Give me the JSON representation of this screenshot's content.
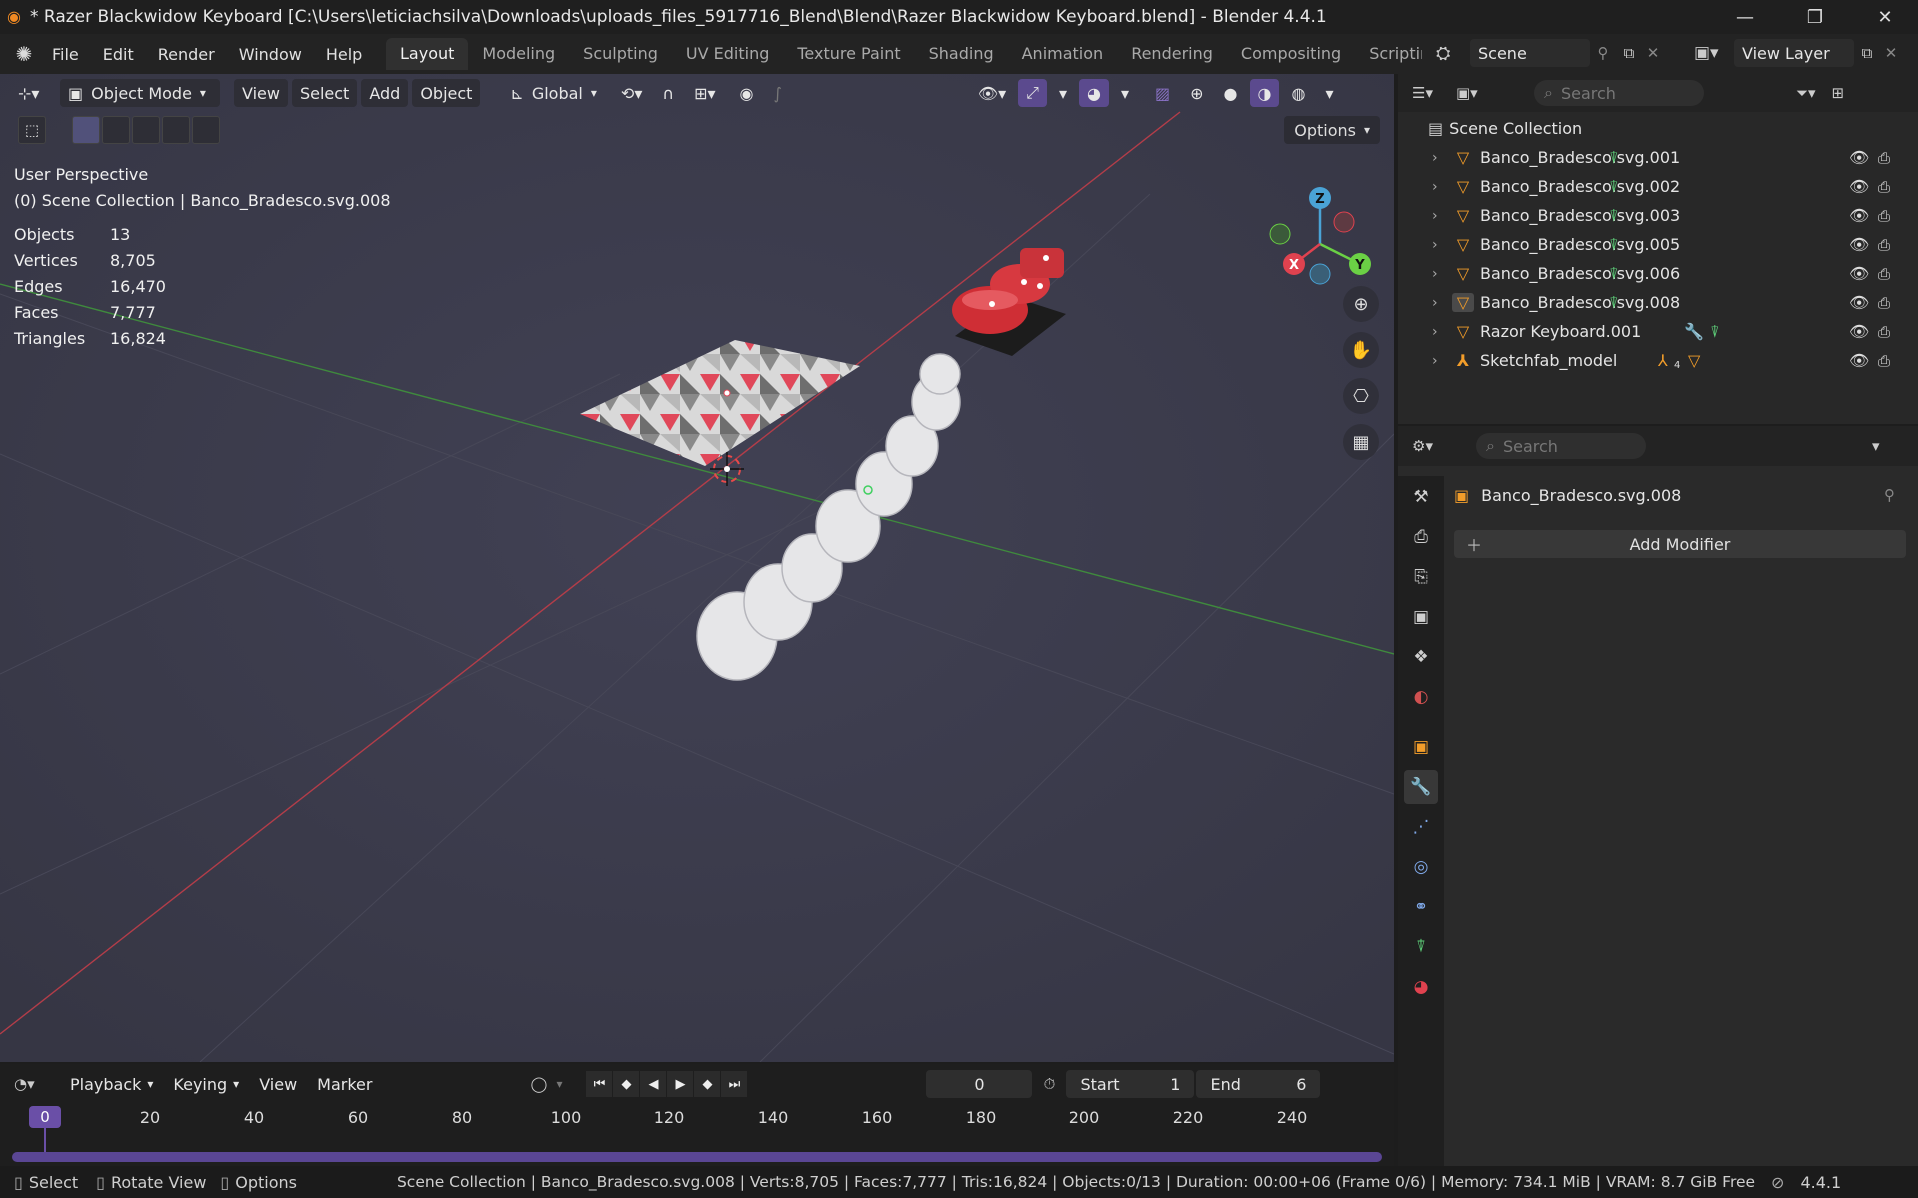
{
  "window": {
    "title": "* Razer Blackwidow Keyboard [C:\\Users\\leticiachsilva\\Downloads\\uploads_files_5917716_Blend\\Blend\\Razer Blackwidow Keyboard.blend] - Blender 4.4.1",
    "minimize": "—",
    "maximize": "❐",
    "close": "✕"
  },
  "menu": {
    "items": [
      "File",
      "Edit",
      "Render",
      "Window",
      "Help"
    ],
    "workspaces": [
      "Layout",
      "Modeling",
      "Sculpting",
      "UV Editing",
      "Texture Paint",
      "Shading",
      "Animation",
      "Rendering",
      "Compositing",
      "Scriptin"
    ],
    "scene": "Scene",
    "view_layer": "View Layer"
  },
  "viewport": {
    "mode": "Object Mode",
    "menus": [
      "View",
      "Select",
      "Add",
      "Object"
    ],
    "orientation": "Global",
    "options": "Options",
    "view_name": "User Perspective",
    "collection_info": "(0) Scene Collection | Banco_Bradesco.svg.008",
    "stats": [
      {
        "label": "Objects",
        "value": "13"
      },
      {
        "label": "Vertices",
        "value": "8,705"
      },
      {
        "label": "Edges",
        "value": "16,470"
      },
      {
        "label": "Faces",
        "value": "7,777"
      },
      {
        "label": "Triangles",
        "value": "16,824"
      }
    ],
    "gizmo": {
      "x": "X",
      "y": "Y",
      "z": "Z"
    }
  },
  "outliner": {
    "search_placeholder": "Search",
    "root": "Scene Collection",
    "items": [
      "Banco_Bradesco.svg.001",
      "Banco_Bradesco.svg.002",
      "Banco_Bradesco.svg.003",
      "Banco_Bradesco.svg.005",
      "Banco_Bradesco.svg.006",
      "Banco_Bradesco.svg.008",
      "Razor Keyboard.001",
      "Sketchfab_model"
    ],
    "sketchfab_badge": "4"
  },
  "properties": {
    "search_placeholder": "Search",
    "object_name": "Banco_Bradesco.svg.008",
    "add_modifier": "Add Modifier"
  },
  "timeline": {
    "menus": [
      "Playback",
      "Keying",
      "View",
      "Marker"
    ],
    "current_frame": "0",
    "start_label": "Start",
    "start_value": "1",
    "end_label": "End",
    "end_value": "6",
    "ruler_labels": [
      "0",
      "20",
      "40",
      "60",
      "80",
      "100",
      "120",
      "140",
      "160",
      "180",
      "200",
      "220",
      "240"
    ]
  },
  "statusbar": {
    "select": "Select",
    "rotate": "Rotate View",
    "options": "Options",
    "info": "Scene Collection | Banco_Bradesco.svg.008 | Verts:8,705 | Faces:7,777 | Tris:16,824 | Objects:0/13 | Duration: 00:00+06 (Frame 0/6) | Memory: 734.1 MiB | VRAM: 8.7 GiB Free",
    "version": "4.4.1"
  },
  "colors": {
    "accent_orange": "#f29d2a",
    "mesh_green": "#5fd37b",
    "timeline_purple": "#6a4fa7",
    "axis_x": "#e0424f",
    "axis_y": "#6bd045",
    "axis_z": "#4aa3d6"
  }
}
